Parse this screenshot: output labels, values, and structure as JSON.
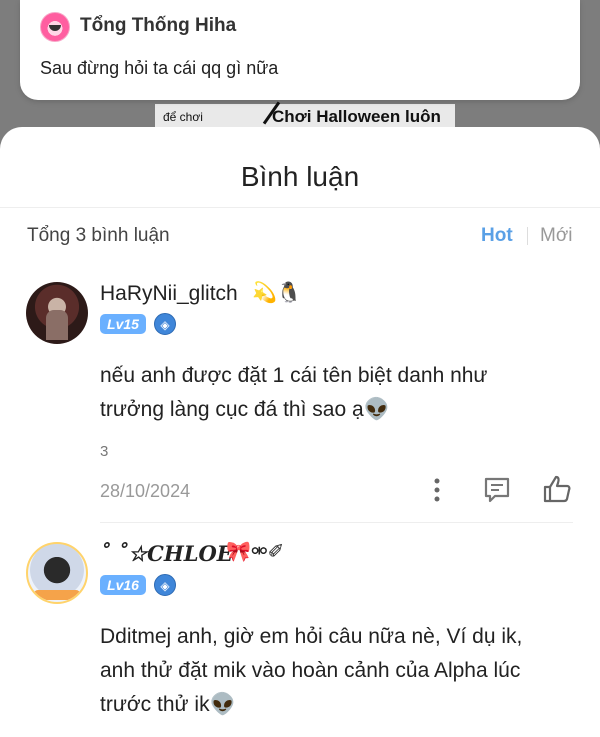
{
  "background": {
    "label_left": "để chơi",
    "label_right": "Chơi Halloween luôn"
  },
  "notification": {
    "title": "Tổng Thống Hiha",
    "message": "Sau đừng hỏi ta cái qq gì nữa"
  },
  "sheet": {
    "title": "Bình luận",
    "total": "Tổng 3 bình luận",
    "sort_hot": "Hot",
    "sort_new": "Mới",
    "accent_color": "#5aa0e6"
  },
  "comments": [
    {
      "username": "HaRyNii_glitch",
      "username_icons": "💫🐧",
      "level": "Lv15",
      "text_line1": "nếu anh được đặt 1 cái tên biệt danh như",
      "text_line2": "trưởng làng cục đá thì sao ạ",
      "text_emoji": "👽",
      "reply_count": "3",
      "date": "28/10/2024"
    },
    {
      "username": "˚ ˚☆CHLOE",
      "username_icons": "🎀⚮✐",
      "level": "Lv16",
      "text_line1": "Dditmej anh, giờ em hỏi câu nữa nè, Ví dụ ik,",
      "text_line2": "anh thử đặt mik vào hoàn cảnh của Alpha lúc",
      "text_line3": "trước thử ik",
      "text_emoji": "👽"
    }
  ]
}
